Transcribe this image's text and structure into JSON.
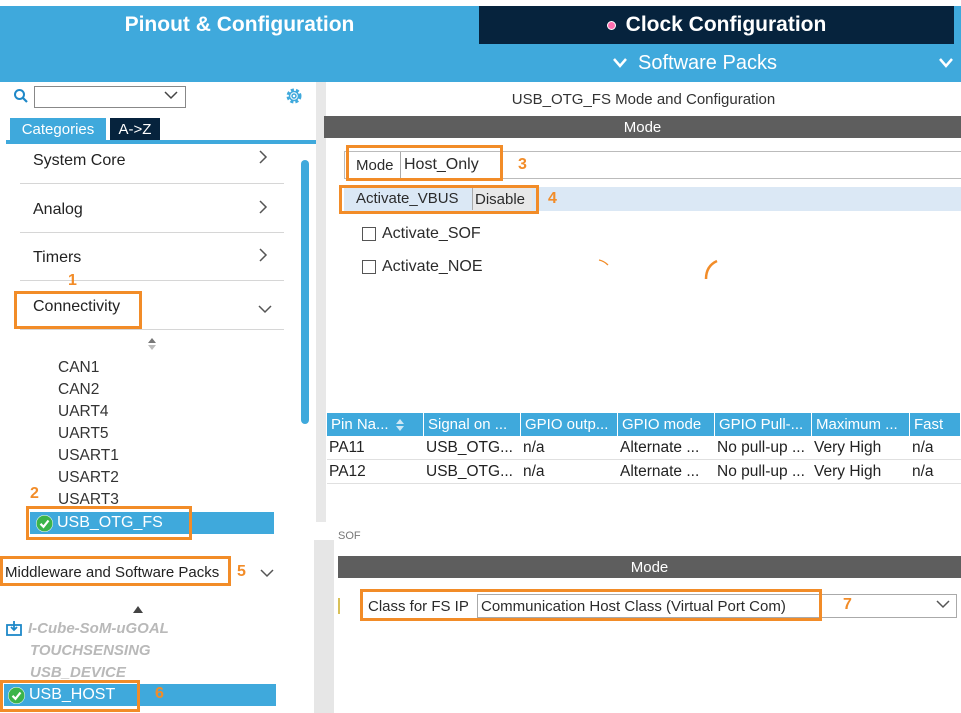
{
  "tabs": {
    "pinout": "Pinout & Configuration",
    "clock": "Clock Configuration",
    "software_packs": "Software Packs"
  },
  "left": {
    "tab_categories": "Categories",
    "tab_az": "A->Z",
    "categories": [
      "System Core",
      "Analog",
      "Timers",
      "Connectivity"
    ],
    "connectivity_items": [
      "CAN1",
      "CAN2",
      "UART4",
      "UART5",
      "USART1",
      "USART2",
      "USART3"
    ],
    "selected_connectivity": "USB_OTG_FS",
    "middleware_label": "Middleware and Software Packs",
    "middleware_items": [
      "I-Cube-SoM-uGOAL",
      "TOUCHSENSING",
      "USB_DEVICE"
    ],
    "selected_middleware": "USB_HOST"
  },
  "config": {
    "title": "USB_OTG_FS Mode and Configuration",
    "mode_header": "Mode",
    "mode_label": "Mode",
    "mode_value": "Host_Only",
    "vbus_label": "Activate_VBUS",
    "vbus_value": "Disable",
    "sof_label": "Activate_SOF",
    "noe_label": "Activate_NOE"
  },
  "table": {
    "headers": [
      "Pin Na...",
      "Signal on ...",
      "GPIO outp...",
      "GPIO mode",
      "GPIO Pull-...",
      "Maximum ...",
      "Fast"
    ],
    "rows": [
      [
        "PA11",
        "USB_OTG...",
        "n/a",
        "Alternate ...",
        "No pull-up ...",
        "Very High",
        "n/a"
      ],
      [
        "PA12",
        "USB_OTG...",
        "n/a",
        "Alternate ...",
        "No pull-up ...",
        "Very High",
        "n/a"
      ]
    ]
  },
  "middleware_config": {
    "fragment": "SOF",
    "mode_header": "Mode",
    "class_label": "Class for FS IP",
    "class_value": "Communication Host Class (Virtual Port Com)"
  },
  "annotations": [
    "1",
    "2",
    "3",
    "4",
    "5",
    "6",
    "7"
  ],
  "colors": {
    "accent_blue": "#3fa9dc",
    "dark_navy": "#06233d",
    "annotation_orange": "#f28c28",
    "mode_bar_gray": "#5e5e5e"
  }
}
